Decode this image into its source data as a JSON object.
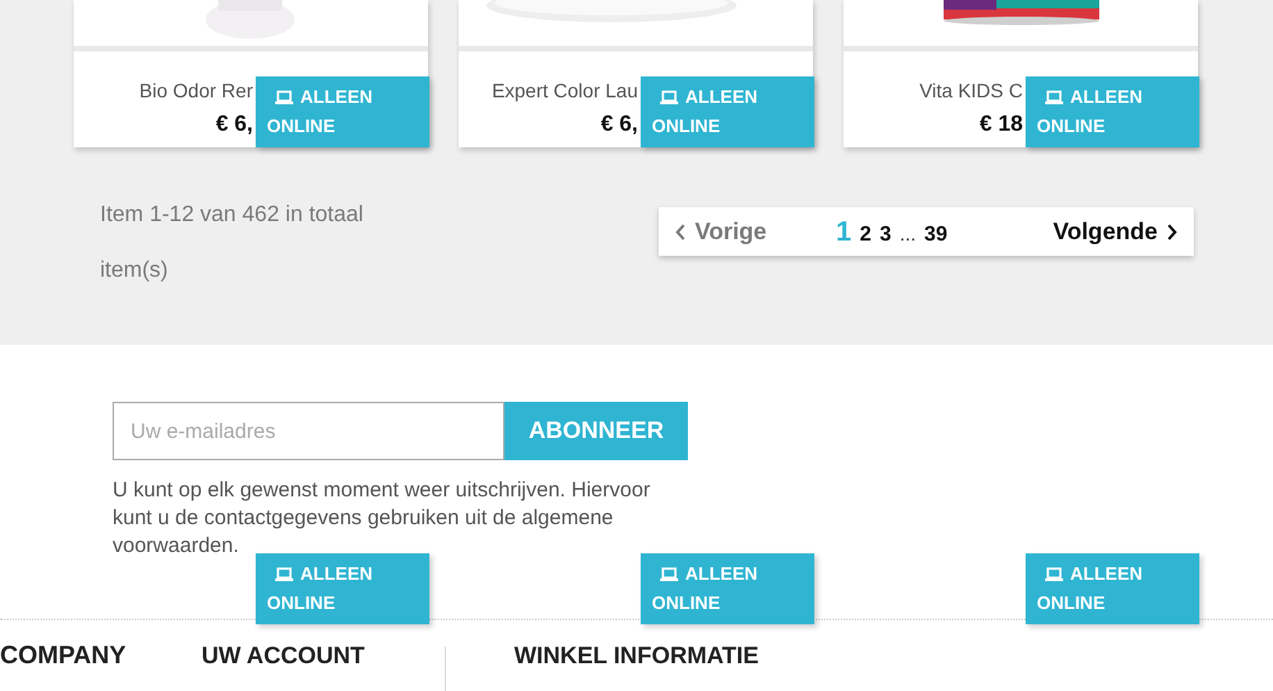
{
  "products": [
    {
      "name": "Bio Odor Rer",
      "price": "€ 6,",
      "badge": "ALLEEN ONLINE"
    },
    {
      "name": "Expert Color Lau",
      "price": "€ 6,",
      "badge": "ALLEEN ONLINE"
    },
    {
      "name": "Vita KIDS C",
      "price": "€ 18",
      "badge": "ALLEEN ONLINE"
    }
  ],
  "pagination": {
    "summary": "Item 1-12 van 462 in totaal item(s)",
    "previous": "Vorige",
    "pages": [
      {
        "label": "1",
        "selected": true
      },
      {
        "label": "2",
        "selected": false
      },
      {
        "label": "3",
        "selected": false
      }
    ],
    "ellipsis": "...",
    "last_page": {
      "label": "39",
      "selected": false
    },
    "next": "Volgende"
  },
  "newsletter": {
    "placeholder": "Uw e-mailadres",
    "button": "ABONNEER",
    "note": "U kunt op elk gewenst moment weer uitschrijven. Hiervoor kunt u de contactgegevens gebruiken uit de algemene voorwaarden."
  },
  "floating_badges": [
    "ALLEEN ONLINE",
    "ALLEEN ONLINE",
    "ALLEEN ONLINE"
  ],
  "footer": {
    "headings": [
      "COMPANY",
      "UW ACCOUNT",
      "WINKEL INFORMATIE"
    ]
  }
}
